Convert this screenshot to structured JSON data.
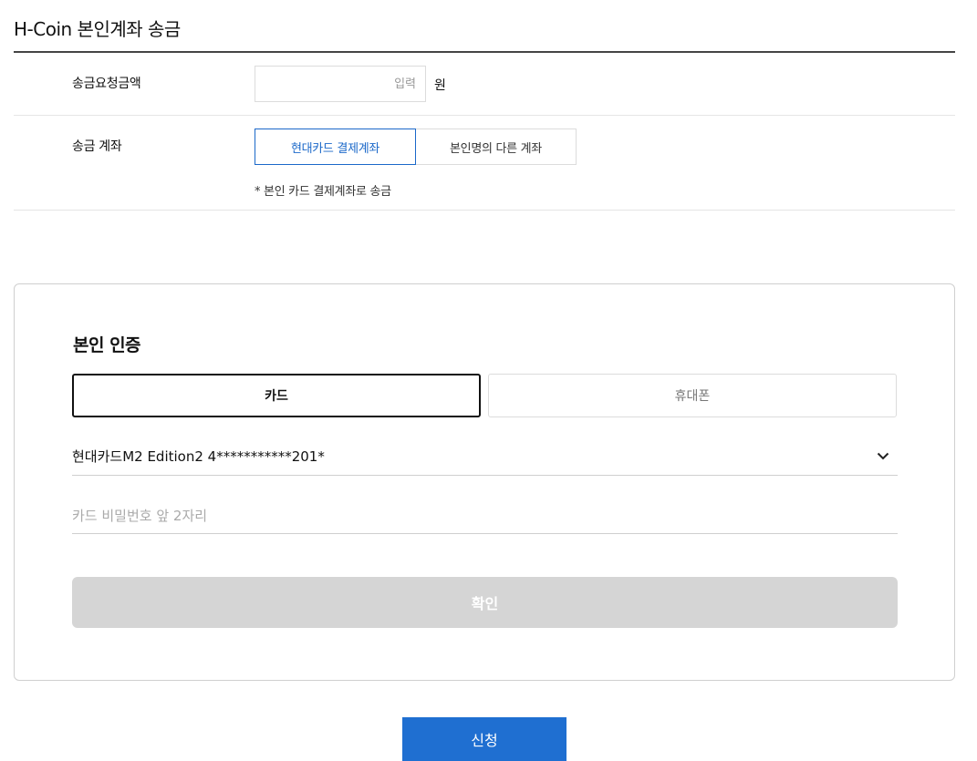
{
  "page": {
    "title": "H-Coin 본인계좌 송금"
  },
  "amount": {
    "label": "송금요청금액",
    "placeholder": "입력",
    "value": "",
    "unit": "원"
  },
  "account": {
    "label": "송금 계좌",
    "options": [
      {
        "label": "현대카드 결제계좌",
        "selected": true
      },
      {
        "label": "본인명의 다른 계좌",
        "selected": false
      }
    ],
    "note": "* 본인 카드 결제계좌로 송금"
  },
  "auth": {
    "title": "본인 인증",
    "tabs": [
      {
        "label": "카드",
        "selected": true
      },
      {
        "label": "휴대폰",
        "selected": false
      }
    ],
    "card_select": {
      "value": "현대카드M2 Edition2 4***********201*",
      "icon": "chevron-down-icon"
    },
    "password": {
      "placeholder": "카드 비밀번호 앞 2자리",
      "value": ""
    },
    "confirm_label": "확인"
  },
  "submit": {
    "label": "신청"
  },
  "colors": {
    "primary": "#1f6fd1",
    "active_border": "#1b68c9",
    "disabled_button": "#d5d5d5"
  }
}
